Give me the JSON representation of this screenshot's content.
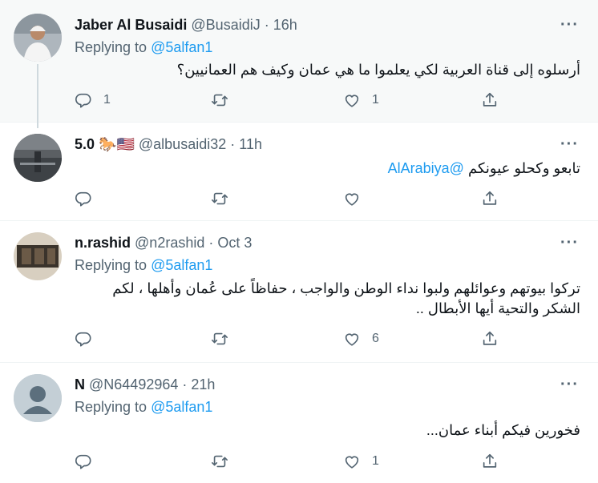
{
  "tweets": [
    {
      "name": "Jaber Al Busaidi",
      "handle": "@BusaidiJ",
      "time": "16h",
      "replying_prefix": "Replying to",
      "replying_to": "@5alfan1",
      "text": "أرسلوه إلى قناة العربية لكي يعلموا ما هي عمان وكيف هم العمانيين؟",
      "counts": {
        "reply": "1",
        "retweet": "",
        "like": "1"
      }
    },
    {
      "name": "5.0",
      "emojis": "🐎🇺🇸",
      "handle": "@albusaidi32",
      "time": "11h",
      "text_mention": "@AlArabiya",
      "text": "تابعو وكحلو عيونكم",
      "counts": {
        "reply": "",
        "retweet": "",
        "like": ""
      }
    },
    {
      "name": "n.rashid",
      "handle": "@n2rashid",
      "time": "Oct 3",
      "replying_prefix": "Replying to",
      "replying_to": "@5alfan1",
      "text_line1": "تركوا بيوتهم وعوائلهم ولبوا نداء الوطن والواجب ، حفاظاً على عُمان وأهلها ، لكم",
      "text_line2": "الشكر والتحية أيها الأبطال ..",
      "counts": {
        "reply": "",
        "retweet": "",
        "like": "6"
      }
    },
    {
      "name": "N",
      "handle": "@N64492964",
      "time": "21h",
      "replying_prefix": "Replying to",
      "replying_to": "@5alfan1",
      "text": "فخورين فيكم أبناء عمان...",
      "counts": {
        "reply": "",
        "retweet": "",
        "like": "1"
      }
    }
  ],
  "separator": "·",
  "more_label": "···"
}
